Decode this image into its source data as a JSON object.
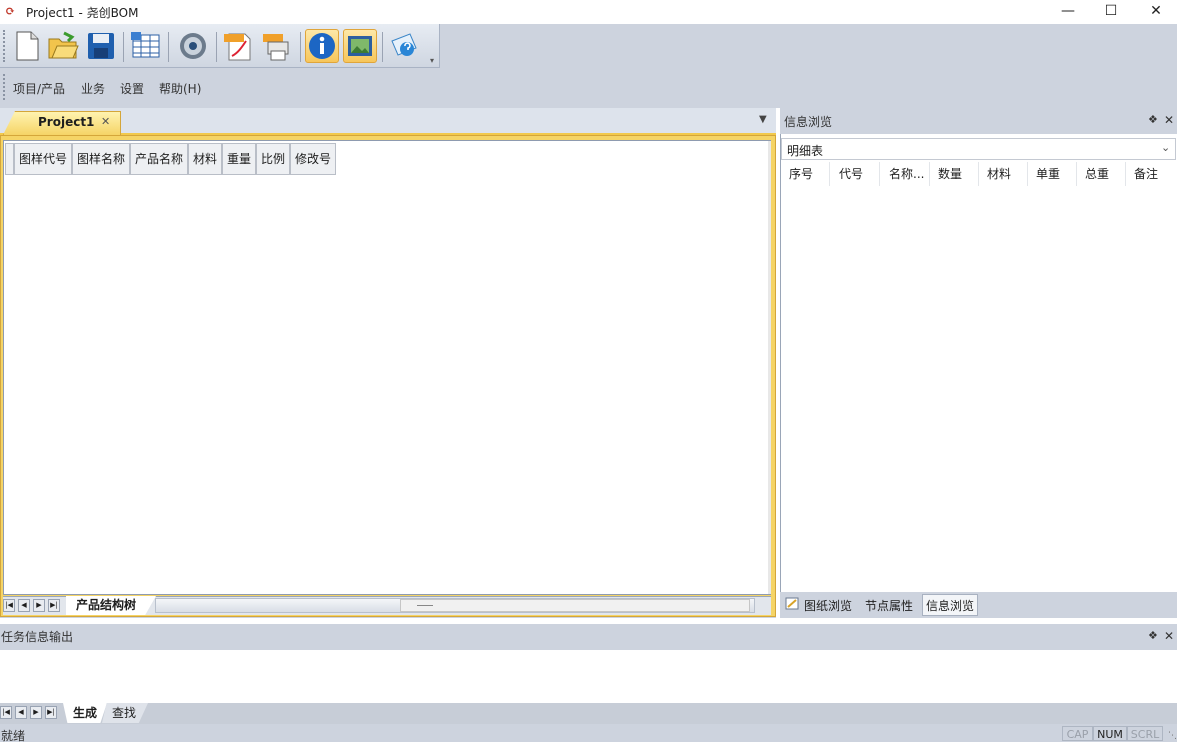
{
  "window": {
    "title": "Project1 - 尧创BOM",
    "app_icon_glyph": "⟳"
  },
  "toolbar": {
    "buttons": [
      "new-file-icon",
      "open-folder-icon",
      "save-icon",
      "table-export-icon",
      "settings-disc-icon",
      "pdf-export-icon",
      "plt-print-icon",
      "info-icon",
      "image-view-icon",
      "help-icon"
    ]
  },
  "menu": {
    "items": [
      "项目/产品",
      "业务",
      "设置",
      "帮助(H)"
    ]
  },
  "document": {
    "tab_label": "Project1",
    "columns": [
      "图样代号",
      "图样名称",
      "产品名称",
      "材料",
      "重量",
      "比例",
      "修改号"
    ],
    "sheet_tab": "产品结构树"
  },
  "right_panel": {
    "title": "信息浏览",
    "combo_value": "明细表",
    "columns": [
      "序号",
      "代号",
      "名称...",
      "数量",
      "材料",
      "单重",
      "总重",
      "备注"
    ],
    "tabs": [
      "图纸浏览",
      "节点属性",
      "信息浏览"
    ]
  },
  "output_panel": {
    "title": "任务信息输出",
    "tabs": [
      "生成",
      "查找"
    ]
  },
  "status": {
    "text": "就绪",
    "cap": "CAP",
    "num": "NUM",
    "scrl": "SCRL"
  },
  "colors": {
    "accent": "#f5d466",
    "chrome": "#cdd3de"
  }
}
